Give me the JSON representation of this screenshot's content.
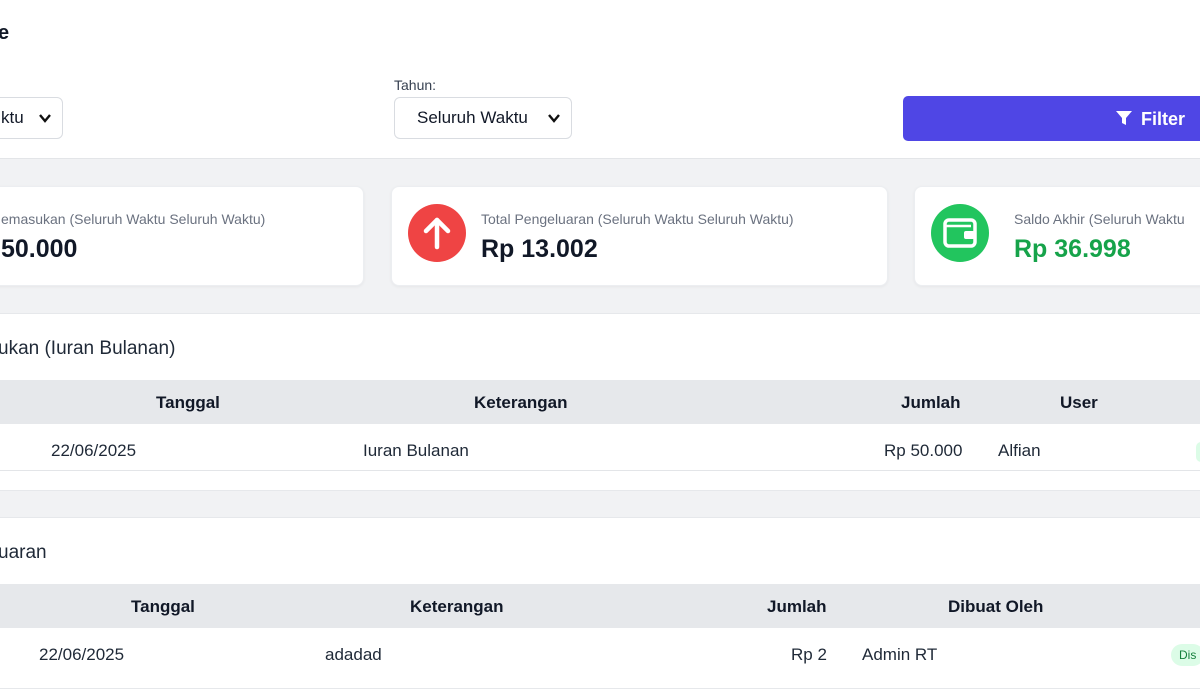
{
  "header": {
    "title_fragment": "e"
  },
  "filters": {
    "month": {
      "value": "ktu"
    },
    "year": {
      "label": "Tahun:",
      "value": "Seluruh Waktu"
    },
    "filter_button": "Filter"
  },
  "cards": [
    {
      "caption": "emasukan (Seluruh Waktu Seluruh Waktu)",
      "amount": "50.000",
      "color": "#2563eb"
    },
    {
      "caption": "Total Pengeluaran (Seluruh Waktu Seluruh Waktu)",
      "amount": "Rp 13.002",
      "color": "#ef4444",
      "icon": "arrow-up-icon"
    },
    {
      "caption": "Saldo Akhir (Seluruh Waktu",
      "amount": "Rp 36.998",
      "color": "#22c55e",
      "icon": "wallet-icon"
    }
  ],
  "income": {
    "title": "ukan (Iuran Bulanan)",
    "columns": [
      "Tanggal",
      "Keterangan",
      "Jumlah",
      "User"
    ],
    "rows": [
      {
        "date": "22/06/2025",
        "desc": "Iuran Bulanan",
        "amount": "Rp 50.000",
        "user": "Alfian"
      }
    ]
  },
  "expense": {
    "title": "uaran",
    "columns": [
      "Tanggal",
      "Keterangan",
      "Jumlah",
      "Dibuat Oleh"
    ],
    "rows": [
      {
        "date": "22/06/2025",
        "desc": "adadad",
        "amount": "Rp 2",
        "created_by": "Admin RT",
        "status": "Dis"
      }
    ]
  },
  "colors": {
    "primary": "#4f46e5",
    "danger": "#ef4444",
    "success": "#22c55e",
    "success_text": "#16a34a"
  }
}
